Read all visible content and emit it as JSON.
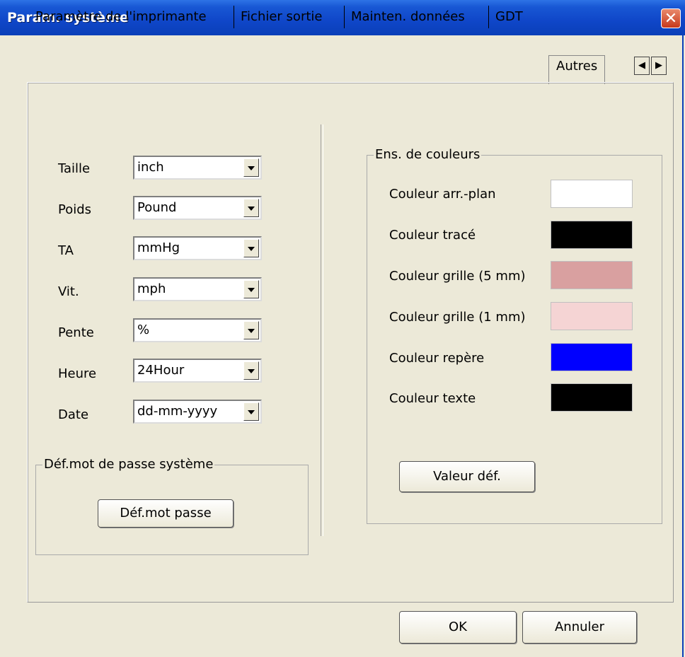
{
  "window": {
    "title": "Param. système",
    "close_icon": "close-icon"
  },
  "tabs": [
    {
      "label": "Paramètre de l'imprimante"
    },
    {
      "label": "Fichier sortie"
    },
    {
      "label": "Mainten. données"
    },
    {
      "label": "GDT"
    },
    {
      "label": "Autres",
      "active": true
    }
  ],
  "units": {
    "size": {
      "label": "Taille",
      "value": "inch"
    },
    "weight": {
      "label": "Poids",
      "value": "Pound"
    },
    "bp": {
      "label": "TA",
      "value": "mmHg"
    },
    "speed": {
      "label": "Vit.",
      "value": "mph"
    },
    "slope": {
      "label": "Pente",
      "value": "%"
    },
    "time": {
      "label": "Heure",
      "value": "24Hour"
    },
    "date": {
      "label": "Date",
      "value": "dd-mm-yyyy"
    }
  },
  "password_group": {
    "legend": "Déf.mot de passe système",
    "button": "Déf.mot passe"
  },
  "colors": {
    "legend": "Ens. de couleurs",
    "items": [
      {
        "label": "Couleur arr.-plan",
        "color": "#ffffff"
      },
      {
        "label": "Couleur tracé",
        "color": "#000000"
      },
      {
        "label": "Couleur grille (5 mm)",
        "color": "#d9a0a0"
      },
      {
        "label": "Couleur grille (1 mm)",
        "color": "#f5d4d4"
      },
      {
        "label": "Couleur repère",
        "color": "#0000ff"
      },
      {
        "label": "Couleur texte",
        "color": "#000000"
      }
    ],
    "default_button": "Valeur déf."
  },
  "footer": {
    "ok": "OK",
    "cancel": "Annuler"
  }
}
